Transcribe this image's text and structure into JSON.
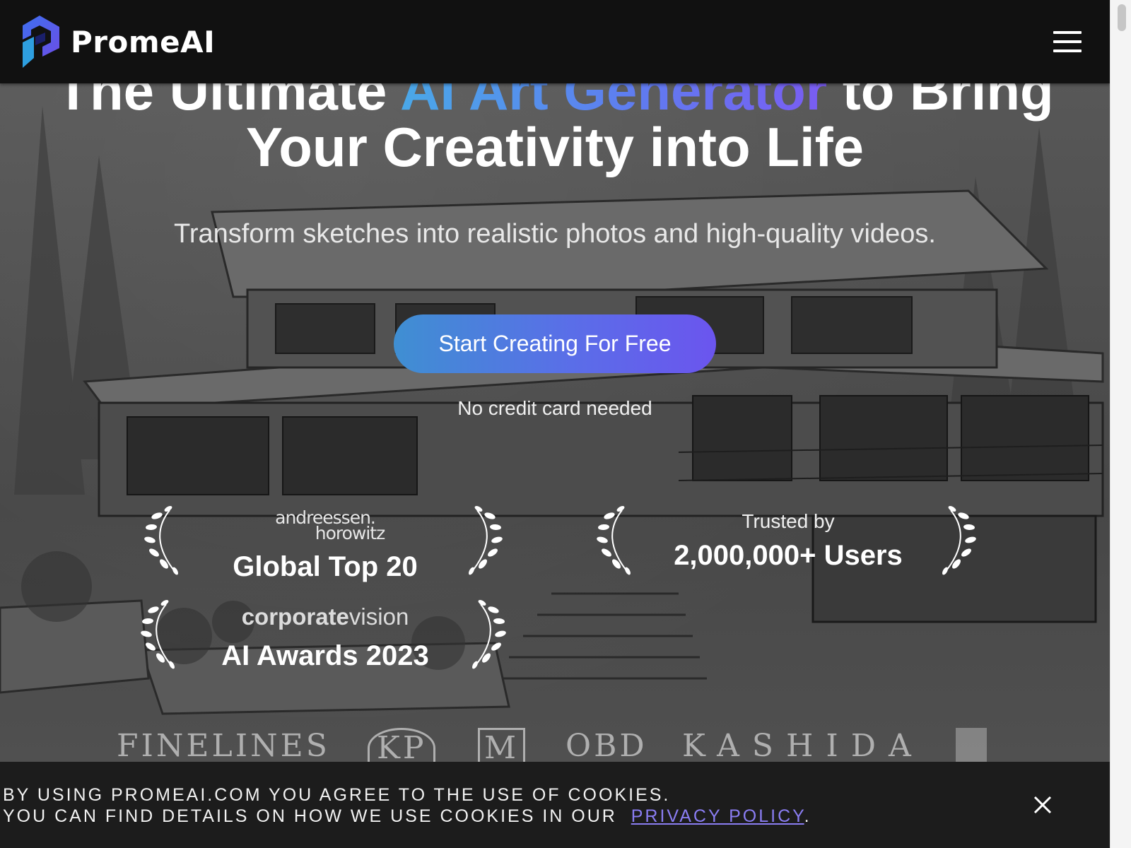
{
  "header": {
    "brand_name": "PromeAI",
    "logo_icon": "promeai-logo-icon",
    "menu_icon": "hamburger-menu-icon"
  },
  "hero": {
    "headline_part1": "The Ultimate ",
    "headline_highlight": "AI Art Generator",
    "headline_part2": " to Bring",
    "headline_line2": "Your Creativity into Life",
    "subtitle": "Transform sketches into realistic photos and high-quality videos.",
    "cta_label": "Start Creating For Free",
    "cta_note": "No credit card needed"
  },
  "awards": [
    {
      "brand_line1": "andreessen.",
      "brand_line2": "horowitz",
      "title": "Global Top 20"
    },
    {
      "kicker": "Trusted by",
      "title": "2,000,000+ Users"
    },
    {
      "brand_bold": "corporate",
      "brand_light": "vision",
      "title": "AI Awards 2023"
    }
  ],
  "partner_logos": [
    "FINELINES",
    "KP",
    "M",
    "OBD",
    "KASHIDA"
  ],
  "cookie_banner": {
    "line1": "By using promeai.com you agree to the use of cookies.",
    "line2_prefix": "You can find details on how we use cookies in our",
    "link_label": "Privacy Policy",
    "line2_suffix": ".",
    "close_icon": "close-icon"
  },
  "colors": {
    "accent_gradient_start": "#4aa8e8",
    "accent_gradient_end": "#7a5cf2",
    "topbar": "#111111",
    "cookie_bg": "#1c1c1c",
    "link": "#8a7df2"
  }
}
